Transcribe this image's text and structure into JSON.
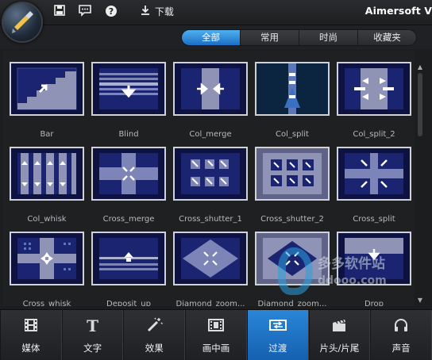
{
  "titlebar": {
    "icons": [
      "save-icon",
      "chat-icon",
      "help-icon"
    ],
    "download_label": "下载",
    "brand": "Aimersoft V"
  },
  "filter_tabs": [
    "全部",
    "常用",
    "时尚",
    "收藏夹"
  ],
  "active_filter": 0,
  "transitions": [
    "Bar",
    "Blind",
    "Col_merge",
    "Col_split",
    "Col_split_2",
    "Col_whisk",
    "Cross_merge",
    "Cross_shutter_1",
    "Cross_shutter_2",
    "Cross_split",
    "Cross_whisk",
    "Deposit_up",
    "Diamond_zoom...",
    "Diamond_zoom...",
    "Drop"
  ],
  "nav": [
    {
      "label": "媒体",
      "icon": "film-icon"
    },
    {
      "label": "文字",
      "icon": "text-icon"
    },
    {
      "label": "效果",
      "icon": "magic-wand-icon"
    },
    {
      "label": "画中画",
      "icon": "pip-icon"
    },
    {
      "label": "过渡",
      "icon": "transition-icon"
    },
    {
      "label": "片头/片尾",
      "icon": "clapperboard-icon"
    },
    {
      "label": "声音",
      "icon": "headphones-icon"
    }
  ],
  "active_nav": 4,
  "watermark": {
    "line1": "多多软件站",
    "line2": "ddooo.com"
  },
  "colors": {
    "accent": "#1f7ad0",
    "thumb_bg": "#0d1240"
  }
}
